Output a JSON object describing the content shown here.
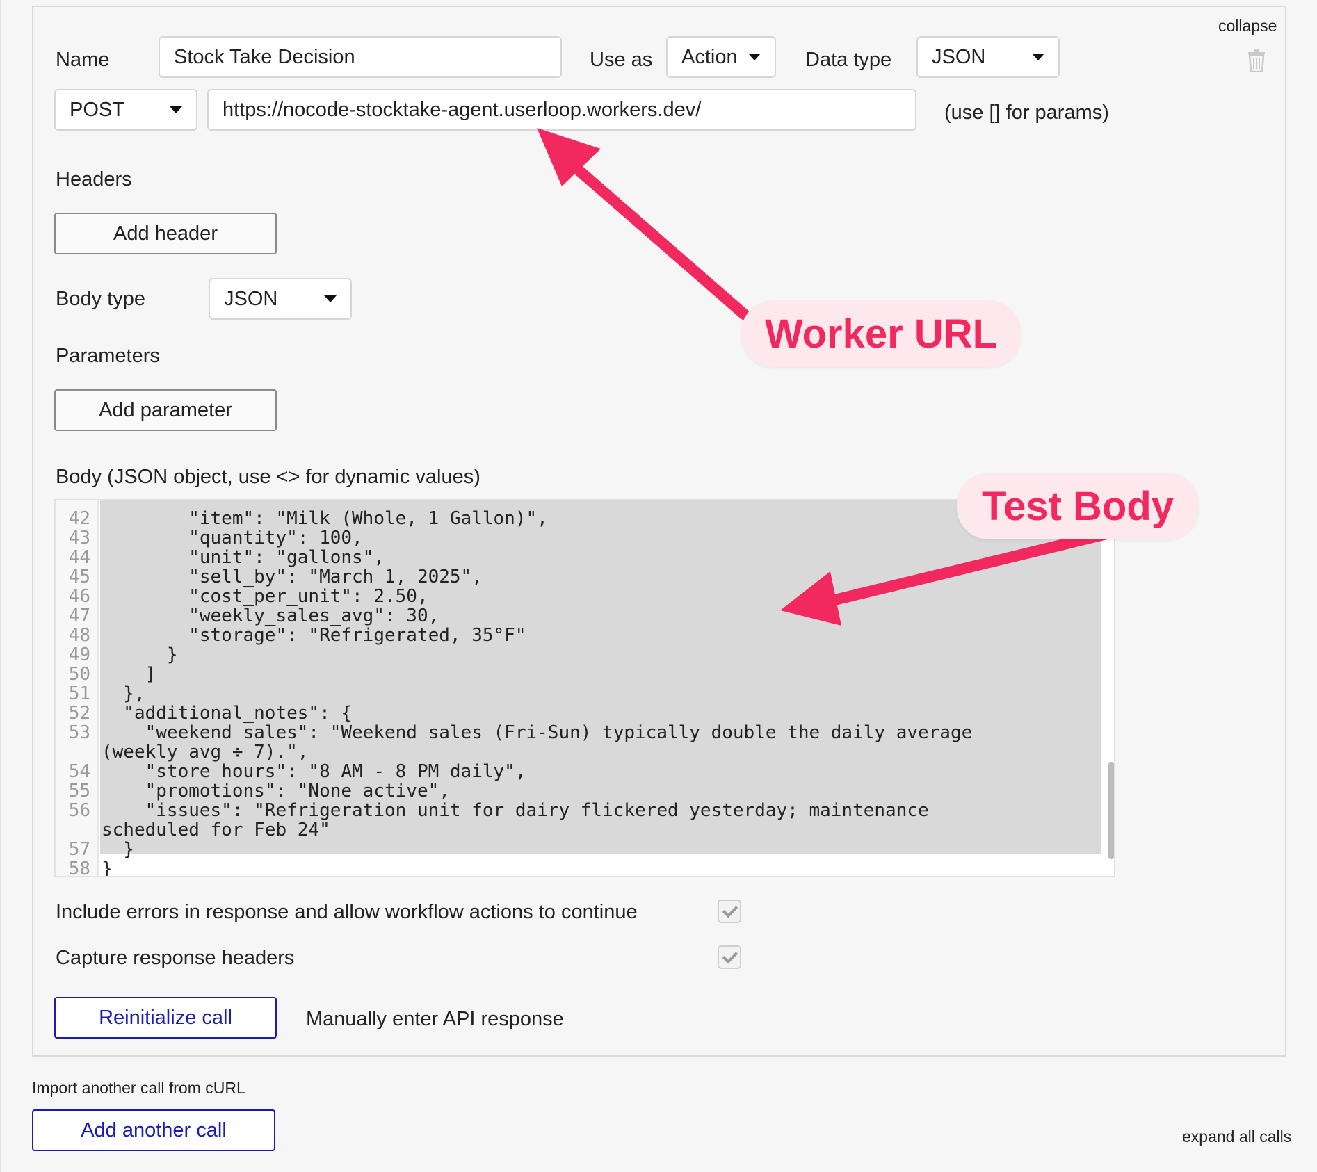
{
  "panel": {
    "collapse_label": "collapse",
    "name_label": "Name",
    "name_value": "Stock Take Decision",
    "use_as_label": "Use as",
    "use_as_value": "Action",
    "data_type_label": "Data type",
    "data_type_value": "JSON",
    "method_value": "POST",
    "url_value": "https://nocode-stocktake-agent.userloop.workers.dev/",
    "params_hint": "(use [] for params)",
    "headers_label": "Headers",
    "add_header_label": "Add header",
    "body_type_label": "Body type",
    "body_type_value": "JSON",
    "parameters_label": "Parameters",
    "add_parameter_label": "Add parameter",
    "body_label": "Body (JSON object, use <> for dynamic values)",
    "include_errors_label": "Include errors in response and allow workflow actions to continue",
    "include_errors_checked": true,
    "capture_headers_label": "Capture response headers",
    "capture_headers_checked": true,
    "reinitialize_label": "Reinitialize call",
    "manual_response_label": "Manually enter API response"
  },
  "editor": {
    "lines": [
      {
        "num": "42",
        "text": "        \"item\": \"Milk (Whole, 1 Gallon)\","
      },
      {
        "num": "43",
        "text": "        \"quantity\": 100,"
      },
      {
        "num": "44",
        "text": "        \"unit\": \"gallons\","
      },
      {
        "num": "45",
        "text": "        \"sell_by\": \"March 1, 2025\","
      },
      {
        "num": "46",
        "text": "        \"cost_per_unit\": 2.50,"
      },
      {
        "num": "47",
        "text": "        \"weekly_sales_avg\": 30,"
      },
      {
        "num": "48",
        "text": "        \"storage\": \"Refrigerated, 35°F\""
      },
      {
        "num": "49",
        "text": "      }"
      },
      {
        "num": "50",
        "text": "    ]"
      },
      {
        "num": "51",
        "text": "  },"
      },
      {
        "num": "52",
        "text": "  \"additional_notes\": {"
      },
      {
        "num": "53",
        "text": "    \"weekend_sales\": \"Weekend sales (Fri-Sun) typically double the daily average"
      },
      {
        "num": "",
        "text": "(weekly avg ÷ 7).\","
      },
      {
        "num": "54",
        "text": "    \"store_hours\": \"8 AM - 8 PM daily\","
      },
      {
        "num": "55",
        "text": "    \"promotions\": \"None active\","
      },
      {
        "num": "56",
        "text": "    \"issues\": \"Refrigeration unit for dairy flickered yesterday; maintenance"
      },
      {
        "num": "",
        "text": "scheduled for Feb 24\""
      },
      {
        "num": "57",
        "text": "  }"
      },
      {
        "num": "58",
        "text": "}"
      }
    ]
  },
  "annotations": {
    "worker_url": "Worker URL",
    "test_body": "Test Body",
    "color": "#f2295f",
    "bg_color": "#fde8ee"
  },
  "footer": {
    "import_curl_label": "Import another call from cURL",
    "add_call_label": "Add another call",
    "expand_all_label": "expand all calls"
  },
  "colors": {
    "link_blue": "#1b1bb5",
    "selection_gray": "#d9d9d9"
  },
  "icons": {
    "delete": "trash-icon",
    "dropdown": "caret-down-icon",
    "checkbox": "checkmark-icon"
  }
}
